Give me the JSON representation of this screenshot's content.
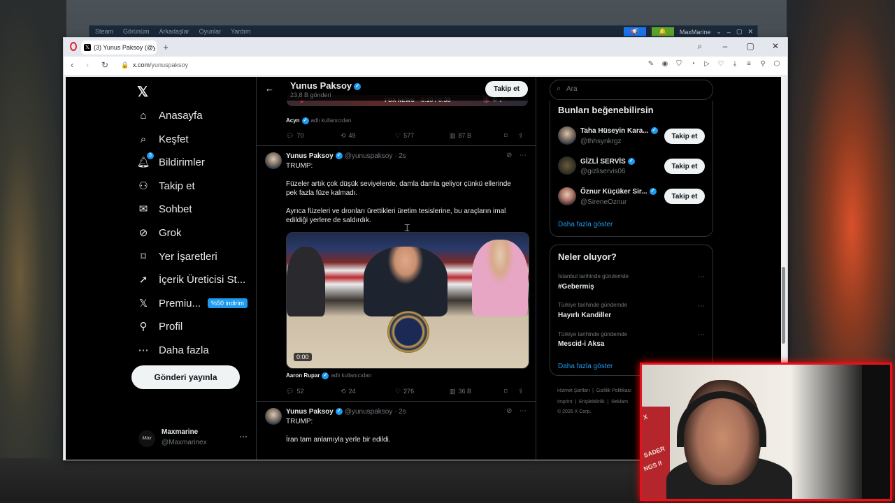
{
  "steam": {
    "menu": [
      "Steam",
      "Görünüm",
      "Arkadaşlar",
      "Oyunlar",
      "Yardım"
    ],
    "user": "MaxMarine"
  },
  "browser": {
    "tab_title": "(3) Yunus Paksoy (@yunus",
    "url_host": "x.com",
    "url_path": "/yunuspaksoy"
  },
  "sidebar": {
    "items": [
      {
        "label": "Anasayfa",
        "icon": "home-icon"
      },
      {
        "label": "Keşfet",
        "icon": "search-icon"
      },
      {
        "label": "Bildirimler",
        "icon": "bell-icon",
        "badge": "3"
      },
      {
        "label": "Takip et",
        "icon": "person-plus-icon"
      },
      {
        "label": "Sohbet",
        "icon": "mail-icon"
      },
      {
        "label": "Grok",
        "icon": "grok-icon"
      },
      {
        "label": "Yer İşaretleri",
        "icon": "bookmark-icon"
      },
      {
        "label": "İçerik Üreticisi St...",
        "icon": "rocket-icon"
      },
      {
        "label": "Premiu...",
        "icon": "x-logo-icon",
        "pill": "%50 indirim"
      },
      {
        "label": "Profil",
        "icon": "person-icon"
      },
      {
        "label": "Daha fazla",
        "icon": "more-circle-icon"
      }
    ],
    "post_button": "Gönderi yayınla",
    "profile_name": "Maxmarine",
    "profile_handle": "@Maxmarinex",
    "profile_avatar_text": "Max"
  },
  "feed": {
    "header_name": "Yunus Paksoy",
    "header_count": "23,8 B gönderi",
    "follow_label": "Takip et",
    "video_time": "0:10 / 0:38",
    "prev_source": "Acyn",
    "prev_stats": {
      "replies": "70",
      "reposts": "49",
      "likes": "577",
      "views": "87 B"
    },
    "posts": [
      {
        "name": "Yunus Paksoy",
        "handle": "@yunuspaksoy · 2s",
        "lines": [
          "TRUMP:",
          "",
          "Füzeler artık çok düşük seviyelerde, damla damla geliyor çünkü ellerinde pek fazla füze kalmadı.",
          "",
          "Ayrıca füzeleri ve dronları ürettikleri üretim tesislerine, bu araçların imal edildiği yerlere de saldırdık."
        ],
        "media_duration": "0:00",
        "source": "Aaron Rupar",
        "stats": {
          "replies": "52",
          "reposts": "24",
          "likes": "276",
          "views": "36 B"
        }
      },
      {
        "name": "Yunus Paksoy",
        "handle": "@yunuspaksoy · 2s",
        "lines": [
          "TRUMP:",
          "",
          "İran tam anlamıyla yerle bir edildi."
        ]
      }
    ],
    "via_label": "adlı kullanıcıdan"
  },
  "right": {
    "search_placeholder": "Ara",
    "suggest_title": "Bunları beğenebilirsin",
    "suggestions": [
      {
        "name": "Taha Hüseyin Kara...",
        "handle": "@thhsynkrgz"
      },
      {
        "name": "GİZLİ SERVİS",
        "handle": "@gizliservis06"
      },
      {
        "name": "Öznur Küçüker Sir...",
        "handle": "@SireneOznur"
      }
    ],
    "follow_label": "Takip et",
    "show_more": "Daha fazla göster",
    "trends_title": "Neler oluyor?",
    "trends": [
      {
        "meta": "İstanbul tarihinde gündemde",
        "title": "#Gebermiş"
      },
      {
        "meta": "Türkiye tarihinde gündemde",
        "title": "Hayırlı Kandiller"
      },
      {
        "meta": "Türkiye tarihinde gündemde",
        "title": "Mescid-i Aksa"
      }
    ],
    "footer": [
      "Hizmet Şartları",
      "Gizlilik Politikası",
      "Imprint",
      "Erişilebilirlik",
      "Reklam",
      "© 2026 X Corp."
    ]
  },
  "webcam": {
    "poster_lines": [
      "X",
      "SADER",
      "NGS II"
    ]
  },
  "colors": {
    "accent": "#1d9bf0",
    "background": "#000000",
    "webcam_border": "#e0141e"
  }
}
